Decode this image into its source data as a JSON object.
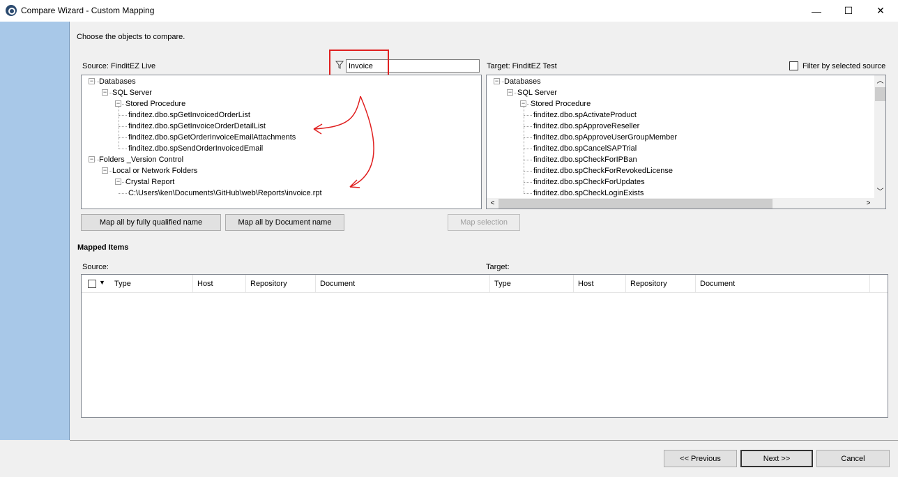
{
  "window": {
    "title": "Compare Wizard - Custom Mapping",
    "minimize_glyph": "—",
    "maximize_glyph": "☐",
    "close_glyph": "✕"
  },
  "instructions": "Choose the objects to compare.",
  "source": {
    "label": "Source: FinditEZ Live",
    "tree": [
      {
        "label": "Databases",
        "level": 0,
        "toggle": "−"
      },
      {
        "label": "SQL Server",
        "level": 1,
        "toggle": "−"
      },
      {
        "label": "Stored Procedure",
        "level": 2,
        "toggle": "−"
      },
      {
        "label": "finditez.dbo.spGetInvoicedOrderList",
        "level": 3
      },
      {
        "label": "finditez.dbo.spGetInvoiceOrderDetailList",
        "level": 3
      },
      {
        "label": "finditez.dbo.spGetOrderInvoiceEmailAttachments",
        "level": 3
      },
      {
        "label": "finditez.dbo.spSendOrderInvoicedEmail",
        "level": 3
      },
      {
        "label": "Folders _Version Control",
        "level": 0,
        "toggle": "−"
      },
      {
        "label": "Local or Network Folders",
        "level": 1,
        "toggle": "−"
      },
      {
        "label": "Crystal Report",
        "level": 2,
        "toggle": "−"
      },
      {
        "label": "C:\\Users\\ken\\Documents\\GitHub\\web\\Reports\\invoice.rpt",
        "level": 3
      }
    ]
  },
  "filter": {
    "icon": "filter-icon",
    "value": "Invoice"
  },
  "target": {
    "label": "Target: FinditEZ Test",
    "filter_checkbox_label": "Filter by selected source",
    "filter_checked": false,
    "tree": [
      {
        "label": "Databases",
        "level": 0,
        "toggle": "−"
      },
      {
        "label": "SQL Server",
        "level": 1,
        "toggle": "−"
      },
      {
        "label": "Stored Procedure",
        "level": 2,
        "toggle": "−"
      },
      {
        "label": "finditez.dbo.spActivateProduct",
        "level": 3
      },
      {
        "label": "finditez.dbo.spApproveReseller",
        "level": 3
      },
      {
        "label": "finditez.dbo.spApproveUserGroupMember",
        "level": 3
      },
      {
        "label": "finditez.dbo.spCancelSAPTrial",
        "level": 3
      },
      {
        "label": "finditez.dbo.spCheckForIPBan",
        "level": 3
      },
      {
        "label": "finditez.dbo.spCheckForRevokedLicense",
        "level": 3
      },
      {
        "label": "finditez.dbo.spCheckForUpdates",
        "level": 3
      },
      {
        "label": "finditez.dbo.spCheckLoginExists",
        "level": 3
      }
    ],
    "scroll_up_glyph": "︿",
    "scroll_down_glyph": "﹀",
    "scroll_left_glyph": "<",
    "scroll_right_glyph": ">"
  },
  "buttons": {
    "map_fqn": "Map all by fully qualified name",
    "map_doc": "Map all by Document name",
    "map_selection": "Map selection",
    "previous": "<< Previous",
    "next": "Next >>",
    "cancel": "Cancel"
  },
  "mapped": {
    "heading": "Mapped Items",
    "source_label": "Source:",
    "target_label": "Target:",
    "columns": [
      "Type",
      "Host",
      "Repository",
      "Document",
      "Type",
      "Host",
      "Repository",
      "Document"
    ]
  },
  "colors": {
    "accent_strip": "#a8c8e8",
    "annotation_red": "#e02020"
  }
}
